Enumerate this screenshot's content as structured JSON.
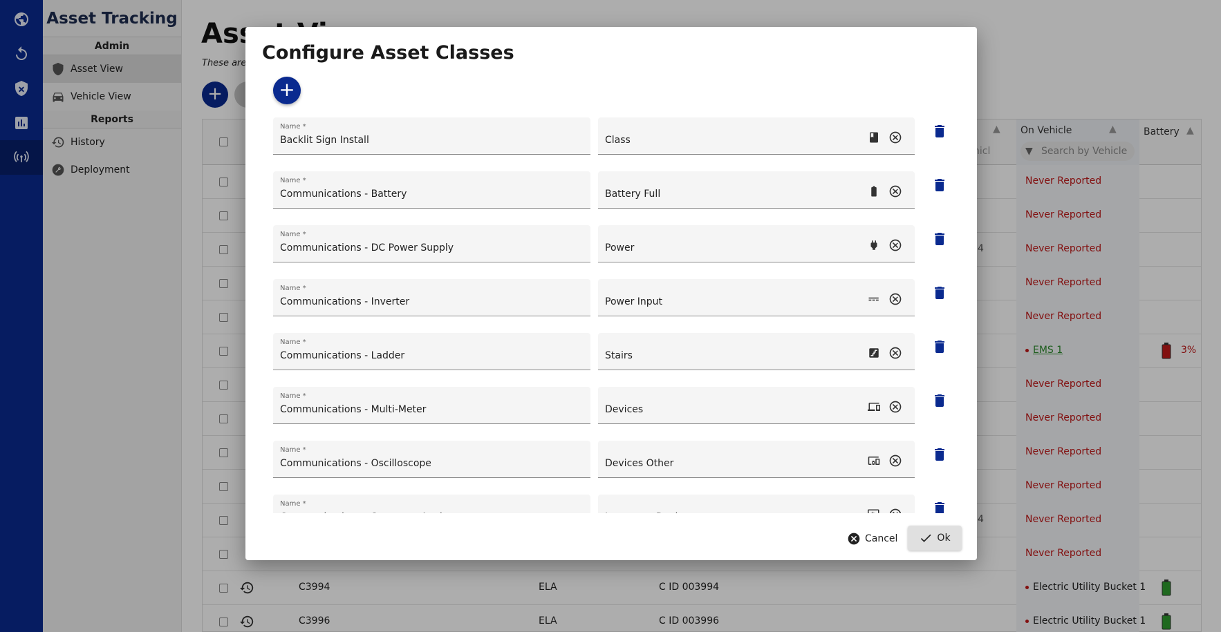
{
  "sidebar": {
    "app_title": "Asset Tracking",
    "admin_header": "Admin",
    "items_admin": [
      {
        "label": "Asset View",
        "icon": "shield-lock-icon"
      },
      {
        "label": "Vehicle View",
        "icon": "car-icon"
      }
    ],
    "reports_header": "Reports",
    "items_reports": [
      {
        "label": "History",
        "icon": "history-icon"
      },
      {
        "label": "Deployment",
        "icon": "wrench-icon"
      }
    ]
  },
  "rail": [
    "globe-icon",
    "refresh-icon",
    "shield-icon",
    "chart-icon",
    "antenna-icon"
  ],
  "page": {
    "title": "Asset View",
    "subtitle": "These are"
  },
  "table": {
    "col_fragment": "hicl",
    "col_on_vehicle": "On Vehicle",
    "col_battery": "Battery",
    "search_placeholder": "Search by Vehicle",
    "rows": [
      {
        "status": "Never Reported"
      },
      {
        "status": "Never Reported"
      },
      {
        "status": "Never Reported",
        "frag": "4"
      },
      {
        "status": "Never Reported"
      },
      {
        "status": "Never Reported"
      },
      {
        "vehicle": "EMS 1",
        "battery": "3%"
      },
      {
        "status": "Never Reported"
      },
      {
        "status": "Never Reported"
      },
      {
        "status": "Never Reported"
      },
      {
        "status": "Never Reported"
      },
      {
        "status": "Never Reported",
        "frag": "4"
      },
      {
        "status": "Never Reported"
      },
      {
        "name": "C3994",
        "org": "ELA",
        "id": "C ID 003994",
        "vehicle": "Electric Utility Bucket 1"
      },
      {
        "name": "C3996",
        "org": "ELA",
        "id": "C ID 003996",
        "vehicle": "Electric Utility Bucket 1"
      }
    ]
  },
  "dialog": {
    "title": "Configure Asset Classes",
    "name_label": "Name *",
    "rows": [
      {
        "name": "Backlit Sign Install",
        "icon_label": "Class",
        "icon": "class-icon"
      },
      {
        "name": "Communications - Battery",
        "icon_label": "Battery Full",
        "icon": "battery-full-icon"
      },
      {
        "name": "Communications - DC Power Supply",
        "icon_label": "Power",
        "icon": "power-plug-icon"
      },
      {
        "name": "Communications - Inverter",
        "icon_label": "Power Input",
        "icon": "power-input-icon"
      },
      {
        "name": "Communications - Ladder",
        "icon_label": "Stairs",
        "icon": "stairs-icon"
      },
      {
        "name": "Communications - Multi-Meter",
        "icon_label": "Devices",
        "icon": "devices-icon"
      },
      {
        "name": "Communications - Oscilloscope",
        "icon_label": "Devices Other",
        "icon": "devices-other-icon"
      },
      {
        "name": "Communications - Spectrum Analyzer",
        "icon_label": "Important Devices",
        "icon": "important-devices-icon"
      }
    ],
    "cancel_label": "Cancel",
    "ok_label": "Ok"
  }
}
